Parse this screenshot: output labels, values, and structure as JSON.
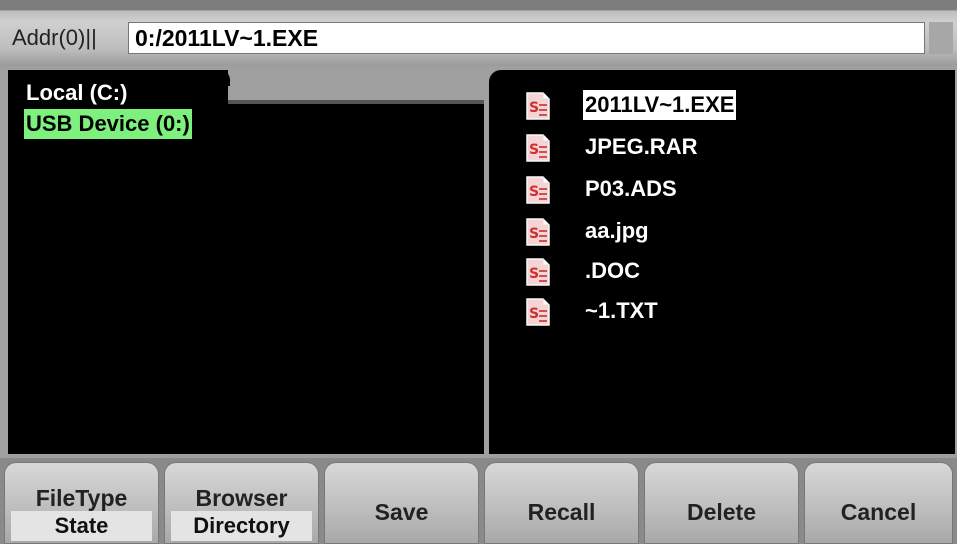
{
  "address": {
    "label": "Addr(0)||",
    "value": "0:/2011LV~1.EXE"
  },
  "directories": [
    {
      "label": "Local (C:)",
      "selected": false
    },
    {
      "label": "USB Device (0:)",
      "selected": true
    }
  ],
  "files": [
    {
      "name": "2011LV~1.EXE",
      "selected": true,
      "icon": "file-icon"
    },
    {
      "name": "JPEG.RAR",
      "selected": false,
      "icon": "file-icon"
    },
    {
      "name": "P03.ADS",
      "selected": false,
      "icon": "file-icon"
    },
    {
      "name": "aa.jpg",
      "selected": false,
      "icon": "file-icon"
    },
    {
      "name": ".DOC",
      "selected": false,
      "icon": "file-icon"
    },
    {
      "name": "~1.TXT",
      "selected": false,
      "icon": "file-icon"
    }
  ],
  "menu": {
    "filetype": {
      "label": "FileType",
      "value": "State"
    },
    "browser": {
      "label": "Browser",
      "value": "Directory"
    },
    "save": "Save",
    "recall": "Recall",
    "delete": "Delete",
    "cancel": "Cancel"
  },
  "colors": {
    "selected_dir_bg": "#7ef07e",
    "selected_file_bg": "#ffffff",
    "panel_bg": "#000000"
  }
}
